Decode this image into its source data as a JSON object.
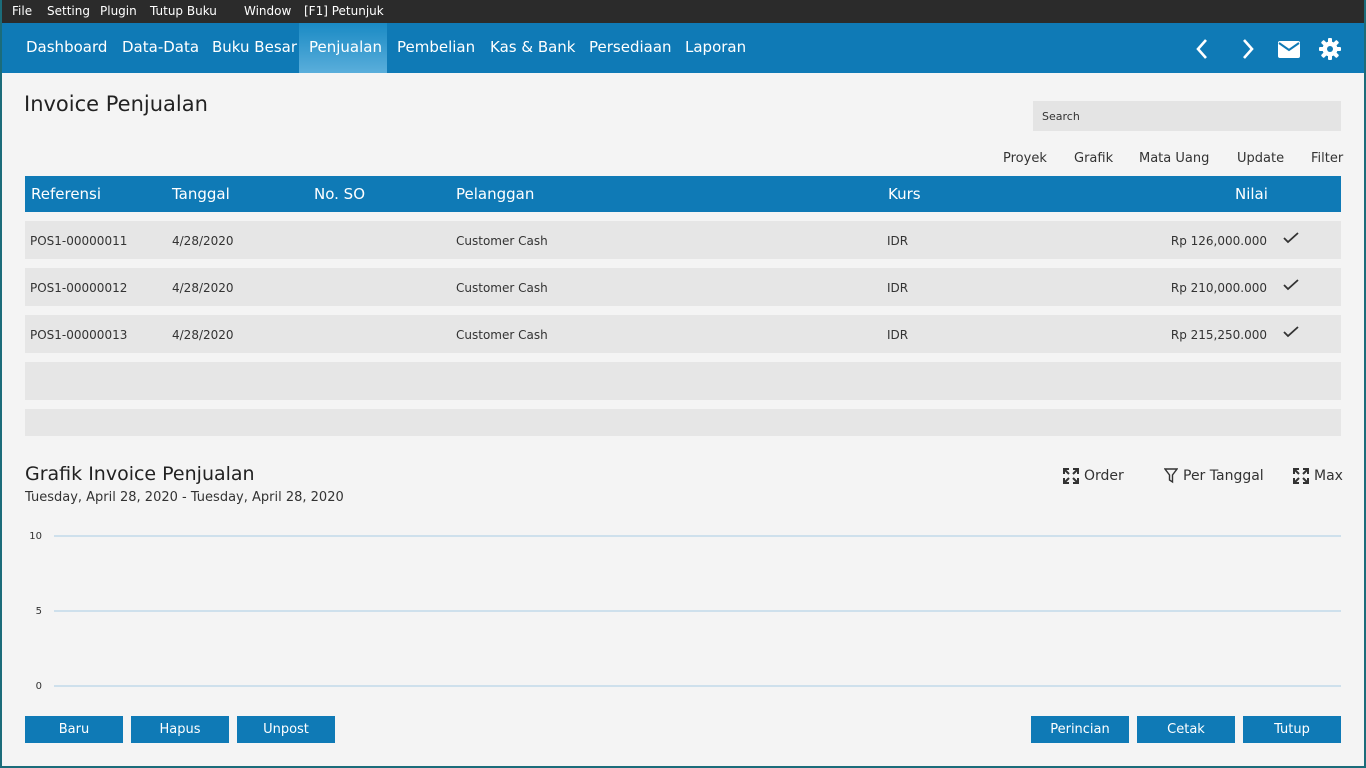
{
  "menubar": {
    "items": [
      "File",
      "Setting",
      "Plugin",
      "Tutup Buku",
      "Window",
      "[F1] Petunjuk"
    ]
  },
  "navbar": {
    "items": [
      "Dashboard",
      "Data-Data",
      "Buku Besar",
      "Penjualan",
      "Pembelian",
      "Kas & Bank",
      "Persediaan",
      "Laporan"
    ],
    "active": "Penjualan",
    "icons": [
      "chevron-left-icon",
      "chevron-right-icon",
      "mail-icon",
      "gear-icon"
    ]
  },
  "page": {
    "title": "Invoice Penjualan",
    "search_placeholder": "Search"
  },
  "toolbar": {
    "proyek": "Proyek",
    "grafik": "Grafik",
    "mata_uang": "Mata Uang",
    "update": "Update",
    "filter": "Filter"
  },
  "table": {
    "columns": {
      "referensi": "Referensi",
      "tanggal": "Tanggal",
      "no_so": "No. SO",
      "pelanggan": "Pelanggan",
      "kurs": "Kurs",
      "nilai": "Nilai"
    },
    "rows": [
      {
        "referensi": "POS1-00000011",
        "tanggal": "4/28/2020",
        "no_so": "",
        "pelanggan": "Customer Cash",
        "kurs": "IDR",
        "nilai": "Rp 126,000.000",
        "posted": true
      },
      {
        "referensi": "POS1-00000012",
        "tanggal": "4/28/2020",
        "no_so": "",
        "pelanggan": "Customer Cash",
        "kurs": "IDR",
        "nilai": "Rp 210,000.000",
        "posted": true
      },
      {
        "referensi": "POS1-00000013",
        "tanggal": "4/28/2020",
        "no_so": "",
        "pelanggan": "Customer Cash",
        "kurs": "IDR",
        "nilai": "Rp 215,250.000",
        "posted": true
      }
    ],
    "empty_rows": 2
  },
  "chart": {
    "title": "Grafik Invoice Penjualan",
    "subtitle": "Tuesday, April 28, 2020 - Tuesday, April 28, 2020",
    "tools": {
      "order": "Order",
      "per_tanggal": "Per Tanggal",
      "max": "Max"
    }
  },
  "chart_data": {
    "type": "bar",
    "categories": [],
    "values": [],
    "title": "",
    "xlabel": "",
    "ylabel": "",
    "ylim": [
      0,
      10
    ],
    "yticks": [
      "10",
      "5",
      "0"
    ],
    "grid": true,
    "line_color": "#a9cde3"
  },
  "buttons": {
    "baru": "Baru",
    "hapus": "Hapus",
    "unpost": "Unpost",
    "perincian": "Perincian",
    "cetak": "Cetak",
    "tutup": "Tutup"
  },
  "colors": {
    "accent": "#0f7ab6",
    "menubar": "#2b2b2b",
    "row": "#e6e6e6"
  }
}
